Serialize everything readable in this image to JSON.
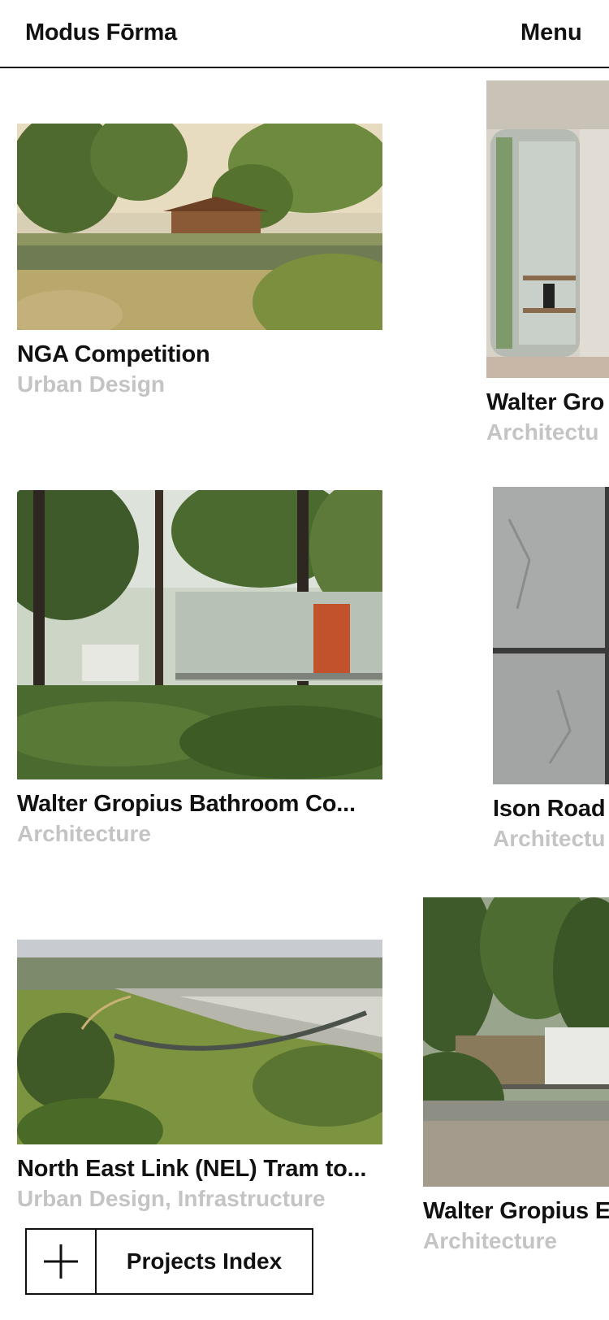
{
  "header": {
    "logo": "Modus Fōrma",
    "menu": "Menu"
  },
  "projects": [
    {
      "title": "NGA Competition",
      "category": "Urban Design",
      "image": "lake landscape with pavilion"
    },
    {
      "title": "Walter Gro",
      "category": "Architectu",
      "image": "circular glass interior"
    },
    {
      "title": "Walter Gropius Bathroom Co...",
      "category": "Architecture",
      "image": "glass pavilion in pine forest"
    },
    {
      "title": "Ison Road",
      "category": "Architectu",
      "image": "stone panel wall"
    },
    {
      "title": "North East Link (NEL) Tram to...",
      "category": "Urban Design, Infrastructure",
      "image": "aerial park and freeway"
    },
    {
      "title": "Walter Gropius E",
      "category": "Architecture",
      "image": "glass pavilion and white box in forest"
    }
  ],
  "index_button": {
    "label": "Projects Index",
    "icon": "plus-icon"
  }
}
